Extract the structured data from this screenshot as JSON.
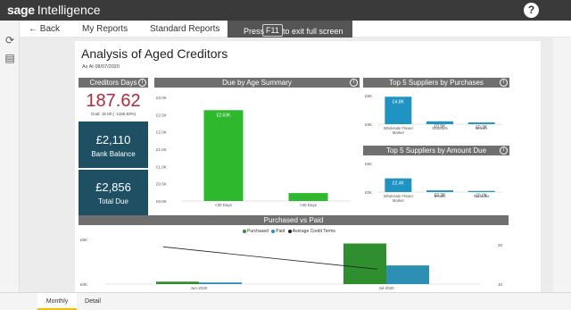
{
  "app": {
    "brand_sage": "sage",
    "brand_name": "Intelligence",
    "help": "?"
  },
  "nav": {
    "back": "← Back",
    "my_reports": "My Reports",
    "standard_reports": "Standard Reports"
  },
  "fullscreen_banner": {
    "press": "Press",
    "key": "F11",
    "rest": "to exit full screen"
  },
  "report": {
    "title": "Analysis of Aged Creditors",
    "as_at": "As At 08/07/2020"
  },
  "creditors_days": {
    "header": "Creditors Days",
    "value": "187.62",
    "goal": "Goal: 15.00 ( -1150.83%)"
  },
  "cards": [
    {
      "value": "£2,110",
      "label": "Bank Balance"
    },
    {
      "value": "£2,856",
      "label": "Total Due"
    }
  ],
  "due_by_age": {
    "header": "Due by Age Summary",
    "yticks": [
      "£3.0K",
      "£2.5K",
      "£2.0K",
      "£1.5K",
      "£1.0K",
      "£0.5K",
      "£0.0K"
    ],
    "categories": [
      "<30 Days",
      ">30 Days"
    ],
    "data_labels": [
      "£2.63K",
      "£0.23K"
    ]
  },
  "top_purchases": {
    "header": "Top 5 Suppliers by Purchases",
    "yticks": [
      "£5K",
      "£0K"
    ],
    "categories": [
      "Wholesale Flower Market",
      "Sundries",
      "Brown"
    ],
    "data_labels": [
      "£4.8K",
      "£0.5K",
      "£0.3K"
    ]
  },
  "top_amount_due": {
    "header": "Top 5 Suppliers by Amount Due",
    "yticks": [
      "£5K",
      "£0K"
    ],
    "categories": [
      "Wholesale Flower Market",
      "Brown",
      "Sundries"
    ],
    "data_labels": [
      "£2.4K",
      "£0.3K",
      "£0.2K"
    ]
  },
  "purchased_vs_paid": {
    "header": "Purchased vs Paid",
    "legend": [
      "Purchased",
      "Paid",
      "Average Credit Terms"
    ],
    "yticks_left": [
      "£5K",
      "£0K"
    ],
    "yticks_right": [
      "20",
      "10"
    ],
    "categories": [
      "Jun-2020",
      "Jul-2020"
    ]
  },
  "tabs": [
    "Monthly",
    "Detail"
  ],
  "colors": {
    "green": "#2db82d",
    "dark_green": "#2f8f2f",
    "teal": "#1f93c2",
    "paid_blue": "#2d8fb3",
    "card_bg": "#1e4f63",
    "header_grey": "#6f6f6f",
    "red": "#b3283c"
  },
  "chart_data": [
    {
      "type": "bar",
      "title": "Due by Age Summary",
      "categories": [
        "<30 Days",
        ">30 Days"
      ],
      "values": [
        2630,
        230
      ],
      "ylim": [
        0,
        3000
      ]
    },
    {
      "type": "bar",
      "title": "Top 5 Suppliers by Purchases",
      "categories": [
        "Wholesale Flower Market",
        "Sundries",
        "Brown"
      ],
      "values": [
        4800,
        500,
        300
      ],
      "ylim": [
        0,
        5000
      ]
    },
    {
      "type": "bar",
      "title": "Top 5 Suppliers by Amount Due",
      "categories": [
        "Wholesale Flower Market",
        "Brown",
        "Sundries"
      ],
      "values": [
        2400,
        300,
        200
      ],
      "ylim": [
        0,
        5000
      ]
    },
    {
      "type": "bar",
      "title": "Purchased vs Paid",
      "categories": [
        "Jun-2020",
        "Jul-2020"
      ],
      "series": [
        {
          "name": "Purchased",
          "values": [
            300,
            5000
          ]
        },
        {
          "name": "Paid",
          "values": [
            200,
            2300
          ]
        },
        {
          "name": "Average Credit Terms",
          "values": [
            25,
            10
          ]
        }
      ],
      "ylim": [
        0,
        5500
      ]
    }
  ]
}
